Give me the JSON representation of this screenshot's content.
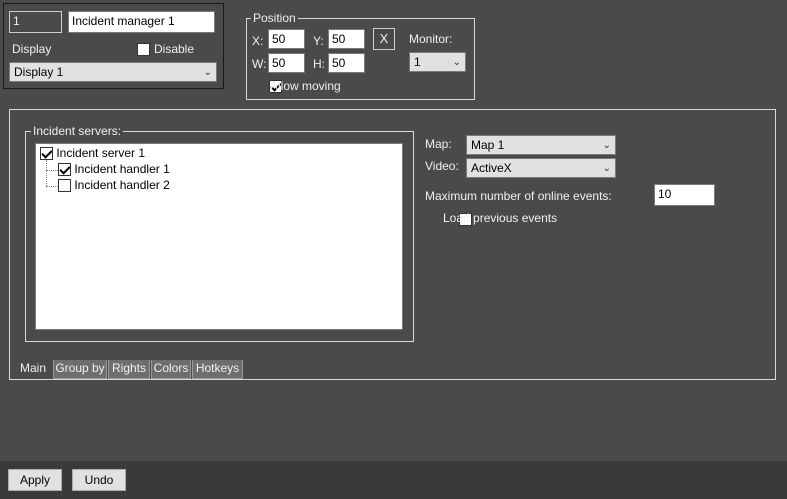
{
  "identity": {
    "id_value": "1",
    "name_value": "Incident manager 1",
    "display_label": "Display",
    "disable_label": "Disable",
    "disable_checked": false,
    "display_selected": "Display 1"
  },
  "position": {
    "legend": "Position",
    "x_label": "X:",
    "x_value": "50",
    "y_label": "Y:",
    "y_value": "50",
    "w_label": "W:",
    "w_value": "50",
    "h_label": "H:",
    "h_value": "50",
    "x_button": "X",
    "monitor_label": "Monitor:",
    "monitor_selected": "1",
    "allow_moving_label": "Allow moving",
    "allow_moving_checked": true
  },
  "incident_servers": {
    "legend": "Incident servers:",
    "items": [
      {
        "label": "Incident server 1",
        "checked": true,
        "level": 0
      },
      {
        "label": "Incident handler 1",
        "checked": true,
        "level": 1
      },
      {
        "label": "Incident handler 2",
        "checked": false,
        "level": 1
      }
    ]
  },
  "settings": {
    "map_label": "Map:",
    "map_selected": "Map 1",
    "video_label": "Video:",
    "video_selected": "ActiveX",
    "max_events_label": "Maximum number of online events:",
    "max_events_value": "10",
    "load_previous_label": "Load previous events",
    "load_previous_checked": false
  },
  "tabs": [
    {
      "label": "Main",
      "active": true
    },
    {
      "label": "Group by",
      "active": false
    },
    {
      "label": "Rights",
      "active": false
    },
    {
      "label": "Colors",
      "active": false
    },
    {
      "label": "Hotkeys",
      "active": false
    }
  ],
  "footer": {
    "apply_label": "Apply",
    "undo_label": "Undo"
  },
  "colors": {
    "background": "#4a4a4a",
    "footer": "#3a3a3a",
    "field": "#ffffff",
    "button": "#e1e1e1"
  }
}
